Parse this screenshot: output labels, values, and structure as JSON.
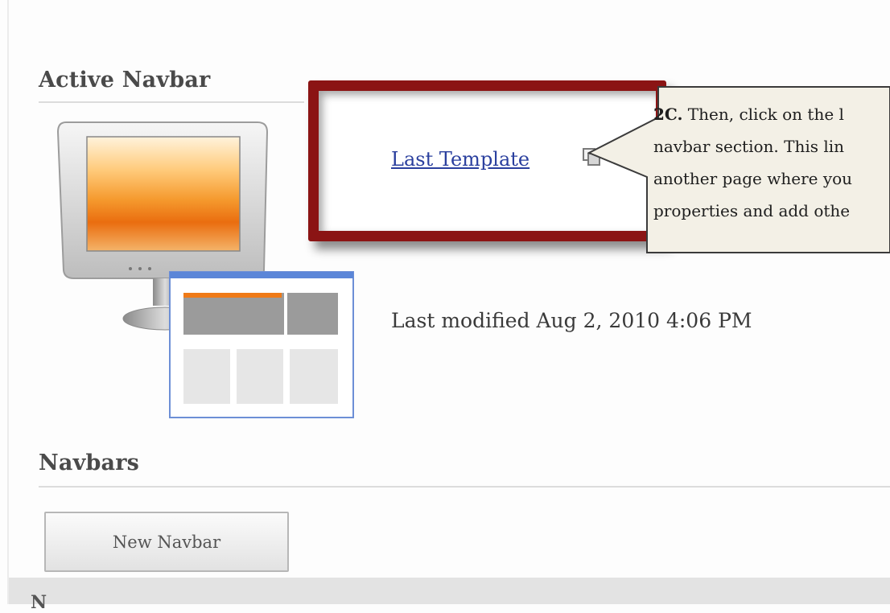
{
  "active_section": {
    "heading": "Active Navbar",
    "template_link": "Last Template",
    "last_modified": "Last modified Aug 2, 2010 4:06 PM"
  },
  "callout": {
    "step": "2C.",
    "lines": [
      " Then, click on the l",
      "navbar section.  This lin",
      "another page where you",
      "properties and add othe"
    ]
  },
  "navbars_section": {
    "heading": "Navbars",
    "new_button_label": "New Navbar",
    "table_header_partial": "N"
  },
  "icons": {
    "monitor": "monitor-icon",
    "layout": "page-layout-icon",
    "copy": "copy-icon"
  },
  "colors": {
    "highlight_border": "#8b1414",
    "link": "#2a3f9e",
    "callout_bg": "#f3f0e6",
    "orange_accent": "#ef7a17"
  }
}
